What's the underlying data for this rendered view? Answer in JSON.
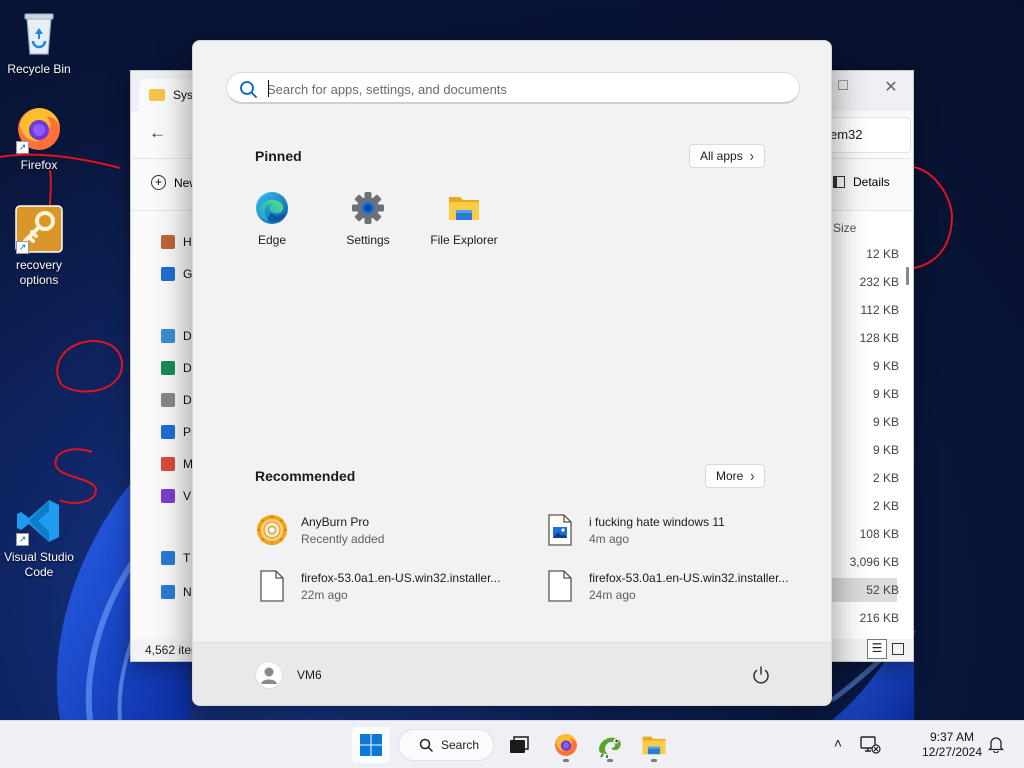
{
  "desktop": {
    "icons": [
      {
        "label": "Recycle Bin"
      },
      {
        "label": "Firefox"
      },
      {
        "label": "recovery options"
      },
      {
        "label": "Visual Studio Code"
      }
    ]
  },
  "explorer": {
    "tab_title": "Syst",
    "address_tail": "em32",
    "new_label": "New",
    "details_label": "Details",
    "nav_items": [
      {
        "letter": "H",
        "icon": "home-icon"
      },
      {
        "letter": "G",
        "icon": "gallery-icon"
      },
      {
        "letter": "D",
        "icon": "desktop-folder-icon"
      },
      {
        "letter": "D",
        "icon": "downloads-icon"
      },
      {
        "letter": "D",
        "icon": "documents-icon"
      },
      {
        "letter": "P",
        "icon": "pictures-icon"
      },
      {
        "letter": "M",
        "icon": "music-icon"
      },
      {
        "letter": "V",
        "icon": "videos-icon"
      },
      {
        "letter": "T",
        "icon": "this-pc-icon"
      },
      {
        "letter": "N",
        "icon": "network-icon"
      }
    ],
    "size_header": "Size",
    "sizes": [
      "12 KB",
      "232 KB",
      "112 KB",
      "128 KB",
      "9 KB",
      "9 KB",
      "9 KB",
      "9 KB",
      "2 KB",
      "2 KB",
      "108 KB",
      "3,096 KB",
      "52 KB",
      "216 KB"
    ],
    "status": "4,562 iter"
  },
  "start_menu": {
    "search_placeholder": "Search for apps, settings, and documents",
    "pinned_title": "Pinned",
    "all_apps_label": "All apps",
    "pinned": [
      {
        "label": "Edge",
        "icon": "edge-icon"
      },
      {
        "label": "Settings",
        "icon": "settings-gear-icon"
      },
      {
        "label": "File Explorer",
        "icon": "file-explorer-icon"
      }
    ],
    "recommended_title": "Recommended",
    "more_label": "More",
    "recommended": [
      {
        "name": "AnyBurn Pro",
        "sub": "Recently added",
        "icon": "anyburn-disc-icon"
      },
      {
        "name": "i fucking hate windows 11",
        "sub": "4m ago",
        "icon": "image-file-icon"
      },
      {
        "name": "firefox-53.0a1.en-US.win32.installer...",
        "sub": "22m ago",
        "icon": "blank-file-icon"
      },
      {
        "name": "firefox-53.0a1.en-US.win32.installer...",
        "sub": "24m ago",
        "icon": "blank-file-icon"
      }
    ],
    "user_name": "VM6"
  },
  "taskbar": {
    "search_label": "Search",
    "time": "9:37 AM",
    "date": "12/27/2024"
  },
  "colors": {
    "accent": "#0067c0",
    "annotation_red": "#e0141e",
    "folder_yellow": "#f4c44c"
  }
}
